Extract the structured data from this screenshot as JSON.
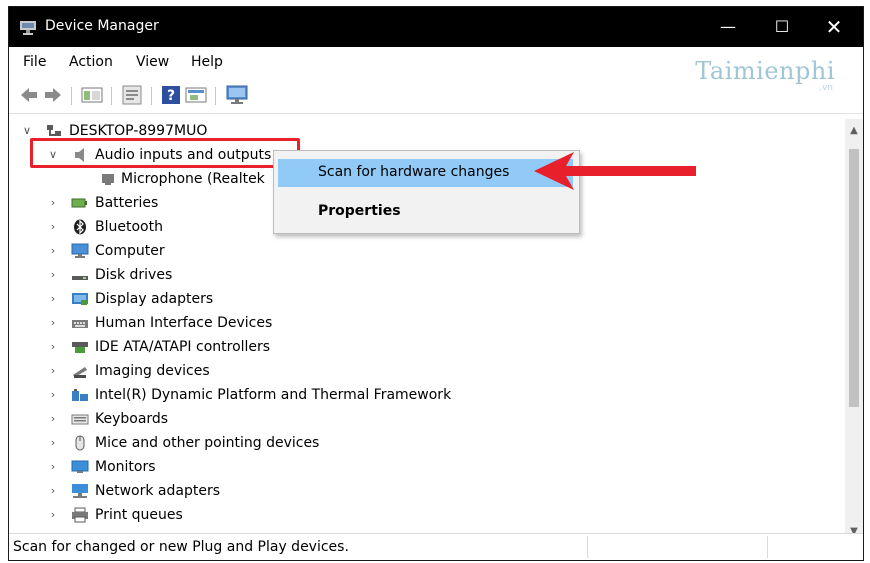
{
  "window": {
    "title": "Device Manager",
    "minimize": "—",
    "maximize": "☐",
    "close": "✕"
  },
  "menu": [
    "File",
    "Action",
    "View",
    "Help"
  ],
  "watermark": {
    "brand": "Taimienphi",
    "suffix": ".vn"
  },
  "tree": {
    "root": "DESKTOP-8997MUO",
    "expanded_category": "Audio inputs and outputs",
    "child": "Microphone (Realtek",
    "categories": [
      "Batteries",
      "Bluetooth",
      "Computer",
      "Disk drives",
      "Display adapters",
      "Human Interface Devices",
      "IDE ATA/ATAPI controllers",
      "Imaging devices",
      "Intel(R) Dynamic Platform and Thermal Framework",
      "Keyboards",
      "Mice and other pointing devices",
      "Monitors",
      "Network adapters",
      "Print queues"
    ]
  },
  "context_menu": {
    "items": [
      "Scan for hardware changes",
      "Properties"
    ],
    "highlighted": "Scan for hardware changes"
  },
  "status": {
    "text": "Scan for changed or new Plug and Play devices."
  },
  "colors": {
    "titlebar": "#000000",
    "annotation_red": "#e8202b",
    "menu_hover": "#91c9f7",
    "watermark": "#9fc6d6"
  }
}
